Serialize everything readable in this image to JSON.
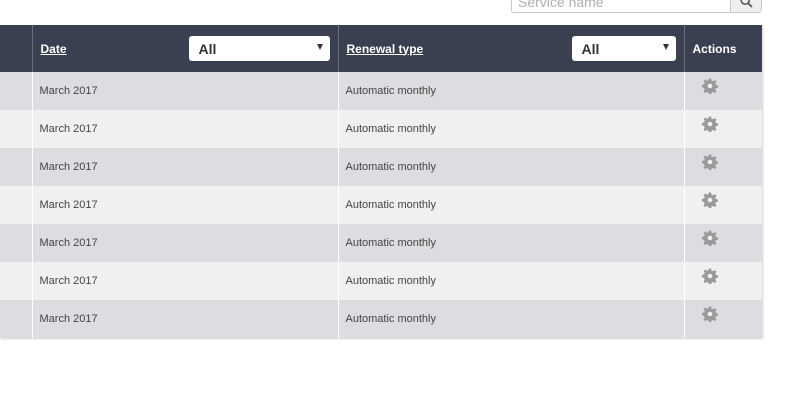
{
  "search": {
    "placeholder": "Service name",
    "button_icon": "search-icon"
  },
  "table": {
    "columns": [
      {
        "label": "",
        "sortable": false
      },
      {
        "label": "Date",
        "sortable": true,
        "filter_value": "All"
      },
      {
        "label": "Renewal type",
        "sortable": true,
        "filter_value": "All"
      },
      {
        "label": "Actions",
        "sortable": false
      }
    ],
    "rows": [
      {
        "date": "March 2017",
        "renewal_type": "Automatic monthly",
        "action_icon": "gear-icon"
      },
      {
        "date": "March 2017",
        "renewal_type": "Automatic monthly",
        "action_icon": "gear-icon"
      },
      {
        "date": "March 2017",
        "renewal_type": "Automatic monthly",
        "action_icon": "gear-icon"
      },
      {
        "date": "March 2017",
        "renewal_type": "Automatic monthly",
        "action_icon": "gear-icon"
      },
      {
        "date": "March 2017",
        "renewal_type": "Automatic monthly",
        "action_icon": "gear-icon"
      },
      {
        "date": "March 2017",
        "renewal_type": "Automatic monthly",
        "action_icon": "gear-icon"
      },
      {
        "date": "March 2017",
        "renewal_type": "Automatic monthly",
        "action_icon": "gear-icon"
      }
    ]
  },
  "colors": {
    "header_bg": "#3b4051",
    "row_odd": "#dcdde0",
    "row_even": "#f0f0f0",
    "icon": "#9a9a9a"
  }
}
